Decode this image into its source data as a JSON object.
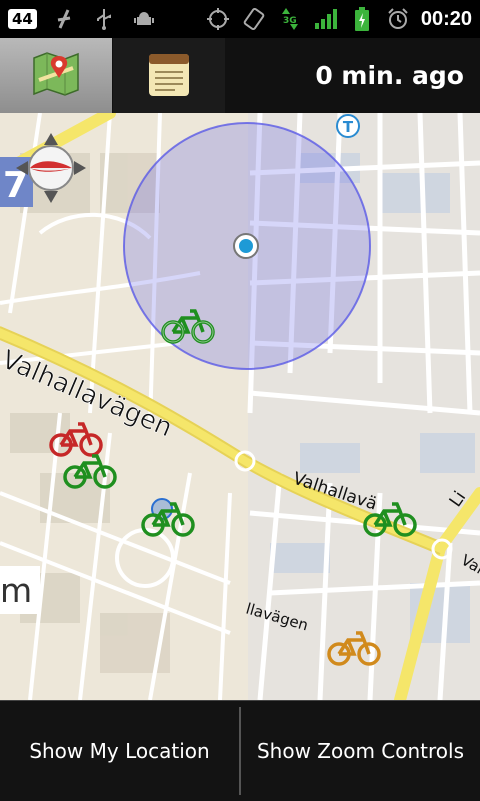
{
  "status_bar": {
    "notification_count": "44",
    "time": "00:20",
    "network_type": "3G",
    "left_icons": [
      "notification-count-icon",
      "missed-call-icon",
      "usb-icon",
      "android-debug-icon"
    ],
    "right_icons": [
      "gps-icon",
      "rotation-icon",
      "data-3g-icon",
      "signal-icon",
      "battery-icon",
      "alarm-icon"
    ]
  },
  "toolbar": {
    "map_tab_icon": "map-pin-icon",
    "notes_tab_icon": "notepad-icon",
    "last_update": "0 min. ago"
  },
  "map": {
    "street_labels": {
      "main_road": "Valhallavägen",
      "main_road_east": "Valhallavä",
      "side_road_1": "Li",
      "side_road_2": "Val",
      "lower_road": "llavägen",
      "label_m": "m",
      "label_7": "7"
    },
    "transit_badge": "T",
    "bike_stations": [
      {
        "status": "available",
        "color": "#1f8f1f"
      },
      {
        "status": "empty",
        "color": "#c62828"
      },
      {
        "status": "available",
        "color": "#1f8f1f"
      },
      {
        "status": "available",
        "color": "#1f8f1f"
      },
      {
        "status": "available",
        "color": "#1f8f1f"
      },
      {
        "status": "low",
        "color": "#d18a1c"
      }
    ],
    "accuracy_circle_color": "#5a5ae6",
    "location_dot_color": "#1e9ad6"
  },
  "bottom_menu": {
    "show_location": "Show My Location",
    "show_zoom": "Show Zoom Controls"
  }
}
